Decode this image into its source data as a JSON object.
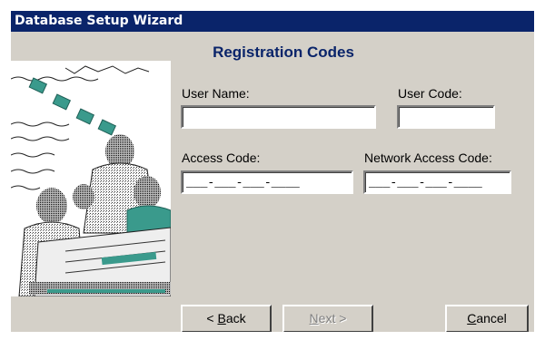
{
  "window": {
    "title": "Database Setup Wizard"
  },
  "page": {
    "heading": "Registration Codes"
  },
  "fields": {
    "user_name": {
      "label": "User Name:",
      "value": ""
    },
    "user_code": {
      "label": "User Code:",
      "value": ""
    },
    "access_code": {
      "label": "Access Code:",
      "mask": "___-___-___-____"
    },
    "network_access_code": {
      "label": "Network Access Code:",
      "mask": "___-___-___-____"
    }
  },
  "buttons": {
    "back": {
      "mnemonic": "B",
      "rest": "ack",
      "prefix": "< "
    },
    "next": {
      "mnemonic": "N",
      "rest": "ext",
      "suffix": " >"
    },
    "cancel": {
      "mnemonic": "C",
      "rest": "ancel"
    }
  },
  "colors": {
    "title_bar": "#0a246a",
    "dialog_face": "#d4d0c8",
    "heading": "#0a246a",
    "art_teal": "#3a9a8c"
  },
  "art": {
    "icon": "people-collage-illustration"
  }
}
